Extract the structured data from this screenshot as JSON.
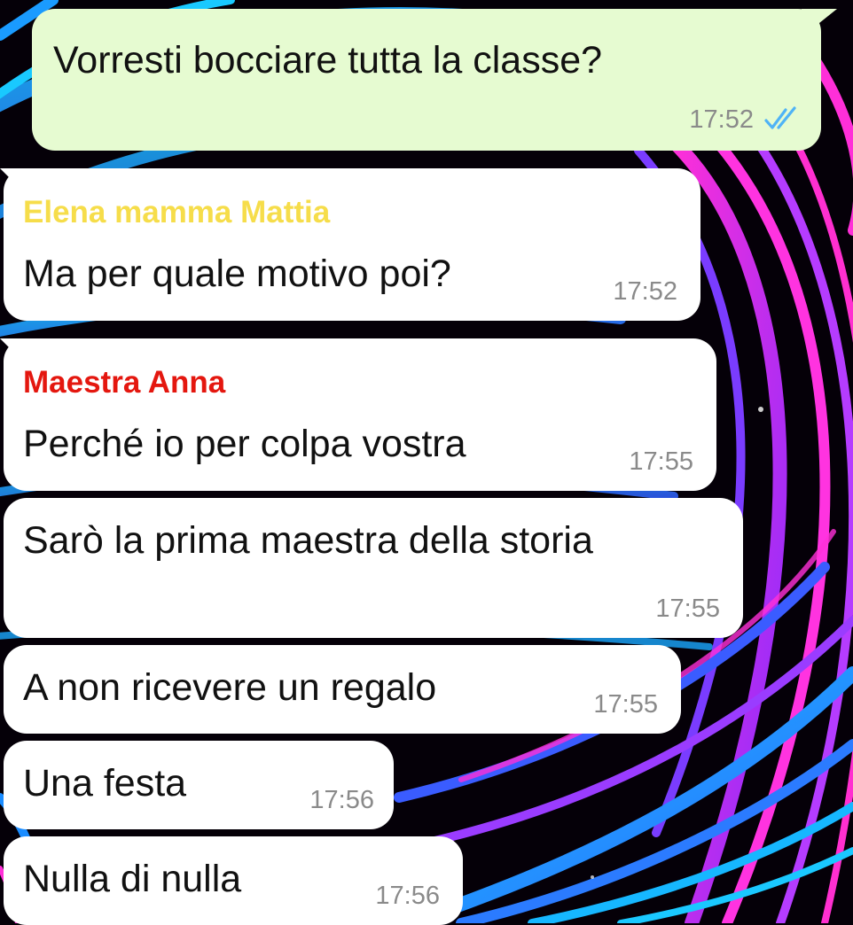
{
  "colors": {
    "outgoing_bubble": "#e6fbd1",
    "incoming_bubble": "#ffffff",
    "sender_elena": "#f6dd4a",
    "sender_anna": "#e4170f",
    "read_ticks": "#4fb3f6",
    "timestamp": "#8a8a8a"
  },
  "messages": [
    {
      "direction": "outgoing",
      "text": "Vorresti bocciare tutta la classe?",
      "time": "17:52",
      "status_icon": "double-check-read-icon"
    },
    {
      "direction": "incoming",
      "sender": "Elena mamma Mattia",
      "text": "Ma per quale motivo poi?",
      "time": "17:52"
    },
    {
      "direction": "incoming",
      "sender": "Maestra Anna",
      "text": "Perché io per colpa vostra",
      "time": "17:55"
    },
    {
      "direction": "incoming",
      "text": "Sarò la prima maestra della storia",
      "time": "17:55"
    },
    {
      "direction": "incoming",
      "text": "A non ricevere un regalo",
      "time": "17:55"
    },
    {
      "direction": "incoming",
      "text": "Una festa",
      "time": "17:56"
    },
    {
      "direction": "incoming",
      "text": "Nulla di nulla",
      "time": "17:56"
    }
  ]
}
